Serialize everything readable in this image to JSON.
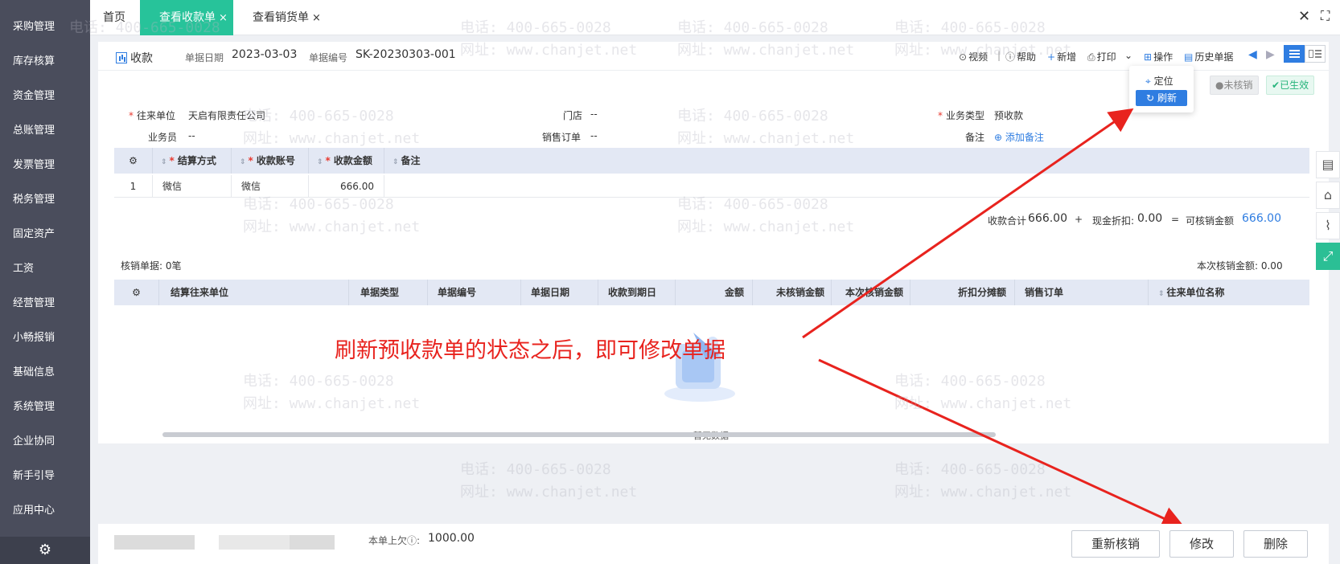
{
  "sidebar": {
    "items": [
      "采购管理",
      "库存核算",
      "资金管理",
      "总账管理",
      "发票管理",
      "税务管理",
      "固定资产",
      "工资",
      "经营管理",
      "小畅报销",
      "基础信息",
      "系统管理",
      "企业协同",
      "新手引导",
      "应用中心"
    ],
    "settings_icon": "gear-icon"
  },
  "tabs": {
    "home": "首页",
    "receipt": "查看收款单",
    "sales": "查看销货单",
    "close_glyph": "×"
  },
  "window": {
    "close": "✕",
    "fullscreen": "⛶"
  },
  "doc": {
    "type": "收款",
    "date_label": "单据日期",
    "date": "2023-03-03",
    "number_label": "单据编号",
    "number": "SK-20230303-001"
  },
  "toolbar": {
    "video": "视频",
    "separator": "|",
    "help": "帮助",
    "new": "新增",
    "print": "打印",
    "operation": "操作",
    "history": "历史单据"
  },
  "popover": {
    "locate": "定位",
    "refresh": "刷新"
  },
  "status": {
    "unverified": "未核销",
    "effective": "已生效"
  },
  "form": {
    "partner_label": "往来单位",
    "partner": "天启有限责任公司",
    "store_label": "门店",
    "store": "--",
    "biz_type_label": "业务类型",
    "biz_type": "预收款",
    "salesman_label": "业务员",
    "salesman": "--",
    "sales_order_label": "销售订单",
    "sales_order": "--",
    "remark_label": "备注",
    "add_remark": "添加备注"
  },
  "payment_table": {
    "headers": [
      "结算方式",
      "收款账号",
      "收款金额",
      "备注"
    ],
    "rows": [
      {
        "index": "1",
        "method": "微信",
        "account": "微信",
        "amount": "666.00",
        "note": ""
      }
    ]
  },
  "totals": {
    "sum_label": "收款合计",
    "sum": "666.00",
    "plus": "+",
    "discount_label": "现金折扣:",
    "discount": "0.00",
    "equals": "=",
    "verifiable_label": "可核销金额",
    "verifiable": "666.00"
  },
  "verify": {
    "count_label": "核销单据: 0笔",
    "amount_label": "本次核销金额: 0.00",
    "headers": [
      "结算往来单位",
      "单据类型",
      "单据编号",
      "单据日期",
      "收款到期日",
      "金额",
      "未核销金额",
      "本次核销金额",
      "折扣分摊额",
      "销售订单",
      "往来单位名称"
    ],
    "empty": "暂无数据"
  },
  "annotation": "刷新预收款单的状态之后，即可修改单据",
  "footer": {
    "owed_label": "本单上欠",
    "owed_value": "1000.00",
    "reverify": "重新核销",
    "edit": "修改",
    "delete": "删除"
  },
  "watermark": {
    "phone": "电话: 400-665-0028",
    "site": "网址: www.chanjet.net"
  },
  "colors": {
    "sidebar": "#4a4d5c",
    "accent": "#27c39a",
    "primary": "#2f7de1",
    "annotation": "#e8231e"
  }
}
